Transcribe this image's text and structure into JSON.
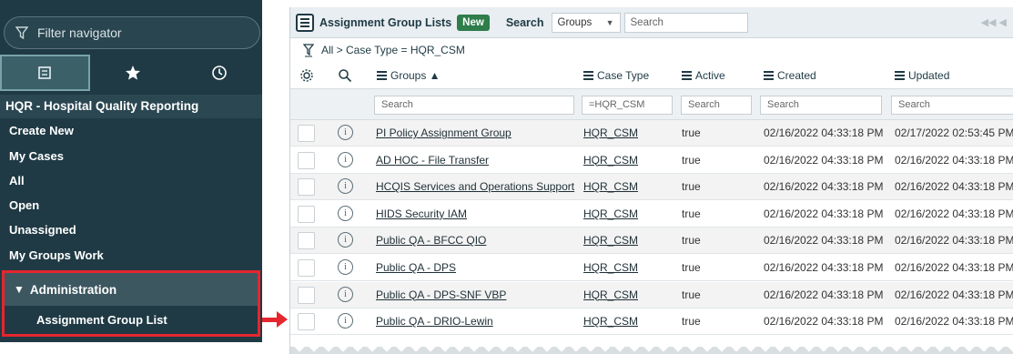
{
  "nav": {
    "filter_placeholder": "Filter navigator",
    "app_title": "HQR - Hospital Quality Reporting",
    "items": [
      "Create New",
      "My Cases",
      "All",
      "Open",
      "Unassigned",
      "My Groups Work"
    ],
    "section": "Administration",
    "section_items": [
      "Assignment Group List"
    ]
  },
  "list": {
    "title": "Assignment Group Lists",
    "new_label": "New",
    "search_label": "Search",
    "search_field": "Groups",
    "search_placeholder": "Search",
    "pager": "◀◀ ◀",
    "breadcrumb": "All > Case Type = HQR_CSM",
    "columns": [
      "Groups ▲",
      "Case Type",
      "Active",
      "Created",
      "Updated"
    ],
    "column_search": [
      "Search",
      "=HQR_CSM",
      "Search",
      "Search",
      "Search"
    ],
    "rows": [
      {
        "group": "PI Policy Assignment Group",
        "case_type": "HQR_CSM",
        "active": "true",
        "created": "02/16/2022 04:33:18 PM",
        "updated": "02/17/2022 02:53:45 PM"
      },
      {
        "group": "AD HOC - File Transfer",
        "case_type": "HQR_CSM",
        "active": "true",
        "created": "02/16/2022 04:33:18 PM",
        "updated": "02/16/2022 04:33:18 PM"
      },
      {
        "group": "HCQIS Services and Operations Support",
        "case_type": "HQR_CSM",
        "active": "true",
        "created": "02/16/2022 04:33:18 PM",
        "updated": "02/16/2022 04:33:18 PM"
      },
      {
        "group": "HIDS Security IAM",
        "case_type": "HQR_CSM",
        "active": "true",
        "created": "02/16/2022 04:33:18 PM",
        "updated": "02/16/2022 04:33:18 PM"
      },
      {
        "group": "Public QA - BFCC QIO",
        "case_type": "HQR_CSM",
        "active": "true",
        "created": "02/16/2022 04:33:18 PM",
        "updated": "02/16/2022 04:33:18 PM"
      },
      {
        "group": "Public QA - DPS",
        "case_type": "HQR_CSM",
        "active": "true",
        "created": "02/16/2022 04:33:18 PM",
        "updated": "02/16/2022 04:33:18 PM"
      },
      {
        "group": "Public QA - DPS-SNF VBP",
        "case_type": "HQR_CSM",
        "active": "true",
        "created": "02/16/2022 04:33:18 PM",
        "updated": "02/16/2022 04:33:18 PM"
      },
      {
        "group": "Public QA - DRIO-Lewin",
        "case_type": "HQR_CSM",
        "active": "true",
        "created": "02/16/2022 04:33:18 PM",
        "updated": "02/16/2022 04:33:18 PM"
      }
    ]
  },
  "colors": {
    "nav_bg": "#1f3a45",
    "highlight_red": "#e5262e",
    "new_green": "#2e7d4a"
  }
}
